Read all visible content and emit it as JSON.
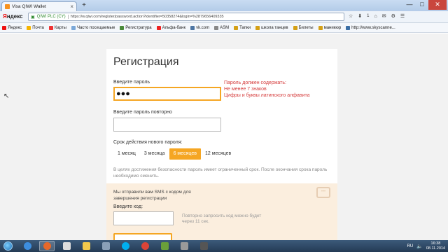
{
  "tab": {
    "title": "Visa QIWI Wallet",
    "close": "×",
    "new_tab": "+"
  },
  "window": {
    "minimize": "—",
    "maximize": "□",
    "close": "✕"
  },
  "nav": {
    "yandex_first": "Я",
    "yandex_rest": "ндекс",
    "secure_label": "QIWI PLC (CY)",
    "url": "https://w.qiwi.com/register/password.action?identifier=50358274&login=%2879656409335",
    "download_count": "1"
  },
  "bookmarks": [
    {
      "label": "Яндекс",
      "color": "#e11"
    },
    {
      "label": "Почта",
      "color": "#f5b400"
    },
    {
      "label": "Карты",
      "color": "#e33"
    },
    {
      "label": "Часто посещаемые",
      "color": "#7aa8d8"
    },
    {
      "label": "Регистратура",
      "color": "#4a8a3a"
    },
    {
      "label": "Альфа-банк",
      "color": "#e22"
    },
    {
      "label": "vk.com",
      "color": "#4c75a3"
    },
    {
      "label": "ASM",
      "color": "#888"
    },
    {
      "label": "Тапки",
      "color": "#d4a017"
    },
    {
      "label": "школа танцев",
      "color": "#d4a017"
    },
    {
      "label": "Билеты",
      "color": "#d4a017"
    },
    {
      "label": "маникюр",
      "color": "#d4a017"
    },
    {
      "label": "http://www.skyscanne...",
      "color": "#3a6ea5"
    }
  ],
  "form": {
    "title": "Регистрация",
    "password_label": "Введите пароль",
    "password_value": "●●●",
    "hint": [
      "Пароль должен содержать:",
      "Не менее 7 знаков",
      "Цифры и буквы латинского алфавита"
    ],
    "repeat_label": "Введите пароль повторно",
    "period_label": "Срок действия нового пароля:",
    "periods": [
      "1 месяц",
      "3 месяца",
      "6 месяцев",
      "12 месяцев"
    ],
    "selected_period": "6 месяцев",
    "note": "В целях достижения безопасности пароль имеет ограниченный срок. После окончания срока пароль необходимо сменить.",
    "sms_text": "Мы отправили вам SMS с кодом для завершения регистрации",
    "code_label": "Введите код:",
    "resend_text": "Повторно запросить код можно будет через 11 сек."
  },
  "taskbar": {
    "lang": "RU",
    "time": "16:38",
    "date": "08.11.2014",
    "apps": [
      {
        "name": "ie",
        "color": "#3d8ee0"
      },
      {
        "name": "firefox",
        "color": "#e8682a"
      },
      {
        "name": "wallet",
        "color": "#ddd"
      },
      {
        "name": "explorer",
        "color": "#f2c94c"
      },
      {
        "name": "files",
        "color": "#8aa0b8"
      },
      {
        "name": "skype",
        "color": "#00aff0"
      },
      {
        "name": "chrome",
        "color": "#db4437"
      },
      {
        "name": "media",
        "color": "#6a9f3a"
      },
      {
        "name": "app",
        "color": "#9a9a9a"
      },
      {
        "name": "app2",
        "color": "#555"
      }
    ]
  }
}
